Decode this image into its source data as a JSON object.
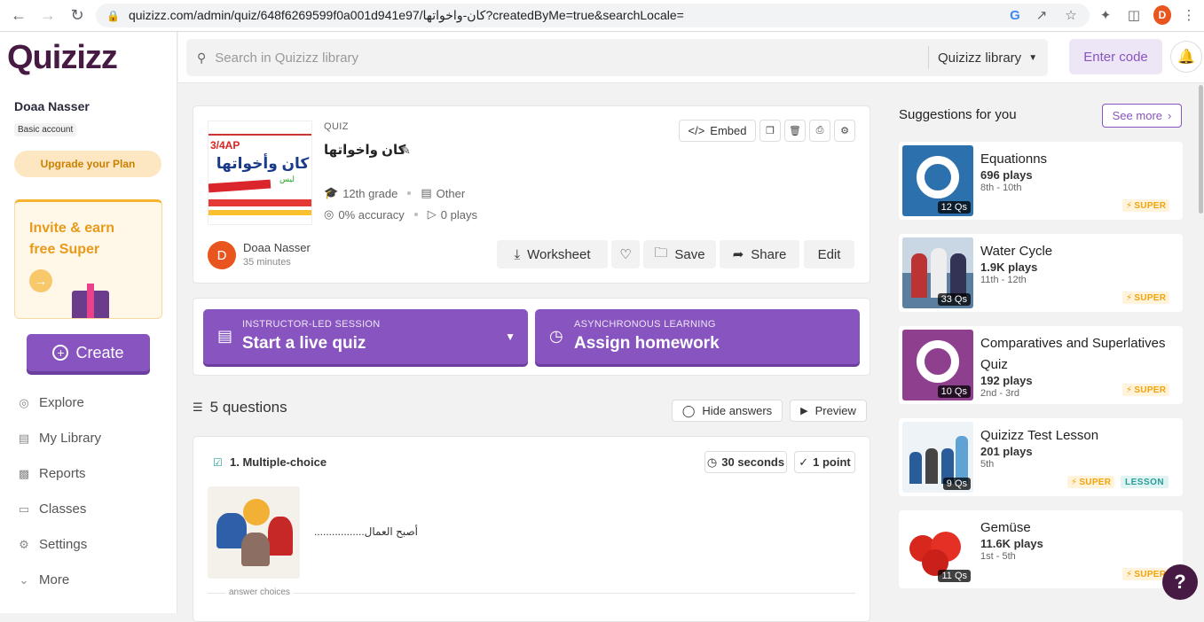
{
  "browser": {
    "url": "quizizz.com/admin/quiz/648f6269599f0a001d941e97/كان-واخواتها?createdByMe=true&searchLocale=",
    "profile_initial": "D"
  },
  "sidebar": {
    "logo": "Quizizz",
    "user_name": "Doaa Nasser",
    "account_type": "Basic account",
    "upgrade_label": "Upgrade your Plan",
    "invite_text": "Invite & earn free Super",
    "create_label": "Create",
    "menu": [
      {
        "label": "Explore",
        "icon": "compass-icon"
      },
      {
        "label": "My Library",
        "icon": "library-icon"
      },
      {
        "label": "Reports",
        "icon": "reports-icon"
      },
      {
        "label": "Classes",
        "icon": "classes-icon"
      },
      {
        "label": "Settings",
        "icon": "gear-icon"
      },
      {
        "label": "More",
        "icon": "chevron-down-icon"
      }
    ]
  },
  "topbar": {
    "search_placeholder": "Search in Quizizz library",
    "library_select": "Quizizz library",
    "enter_code": "Enter code"
  },
  "quiz": {
    "type_label": "QUIZ",
    "title": "كان واخواتها",
    "grade": "12th grade",
    "subject": "Other",
    "accuracy": "0% accuracy",
    "plays": "0 plays",
    "embed_label": "Embed",
    "author": "Doaa Nasser",
    "author_initial": "D",
    "time_ago": "35 minutes",
    "worksheet_label": "Worksheet",
    "save_label": "Save",
    "share_label": "Share",
    "edit_label": "Edit",
    "thumb_title": "كان وأخواتها",
    "thumb_badge": "3/4AP"
  },
  "sessions": {
    "live": {
      "small": "INSTRUCTOR-LED SESSION",
      "large": "Start a live quiz"
    },
    "homework": {
      "small": "ASYNCHRONOUS LEARNING",
      "large": "Assign homework"
    }
  },
  "questions": {
    "count_label": "5 questions",
    "hide_answers": "Hide answers",
    "preview": "Preview",
    "items": [
      {
        "label": "1. Multiple-choice",
        "time": "30 seconds",
        "points": "1 point",
        "text": "أصبح العمال.................",
        "answer_choices_label": "answer choices"
      }
    ]
  },
  "suggestions": {
    "heading": "Suggestions for you",
    "see_more": "See more",
    "items": [
      {
        "title": "Equationns",
        "plays": "696 plays",
        "grades": "8th - 10th",
        "qs": "12 Qs",
        "badges": [
          "SUPER"
        ]
      },
      {
        "title": "Water Cycle",
        "plays": "1.9K plays",
        "grades": "11th - 12th",
        "qs": "33 Qs",
        "badges": [
          "SUPER"
        ]
      },
      {
        "title": "Comparatives and Superlatives Quiz",
        "plays": "192 plays",
        "grades": "2nd - 3rd",
        "qs": "10 Qs",
        "badges": [
          "SUPER"
        ]
      },
      {
        "title": "Quizizz Test Lesson",
        "plays": "201 plays",
        "grades": "5th",
        "qs": "9 Qs",
        "badges": [
          "SUPER",
          "LESSON"
        ]
      },
      {
        "title": "Gemüse",
        "plays": "11.6K plays",
        "grades": "1st - 5th",
        "qs": "11 Qs",
        "badges": [
          "SUPER"
        ]
      }
    ]
  },
  "help_label": "?",
  "colors": {
    "brand": "#8854c0",
    "logo": "#461a42",
    "super": "#f0a30a"
  }
}
